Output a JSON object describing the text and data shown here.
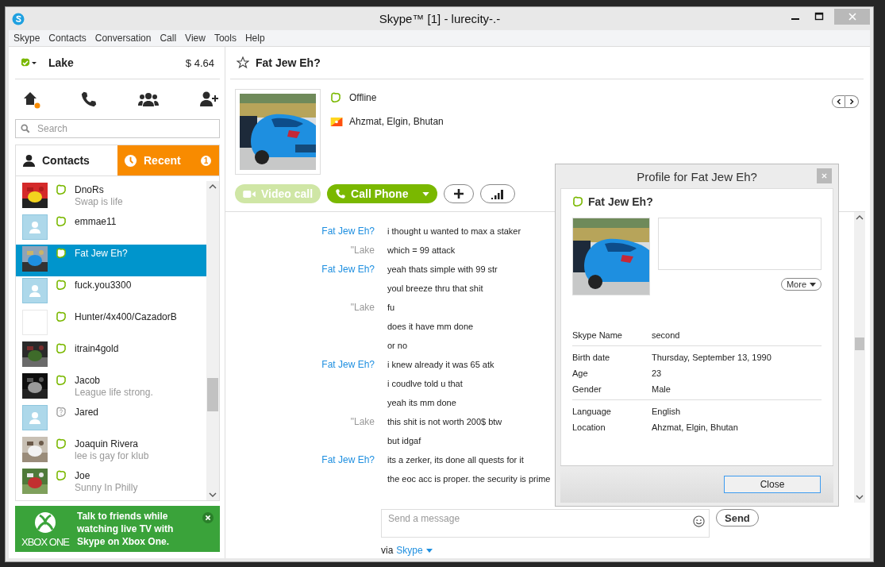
{
  "window": {
    "title": "Skype™ [1] - lurecity-.-"
  },
  "menu": [
    "Skype",
    "Contacts",
    "Conversation",
    "Call",
    "View",
    "Tools",
    "Help"
  ],
  "account": {
    "name": "Lake",
    "credit": "$ 4.64"
  },
  "search": {
    "placeholder": "Search"
  },
  "tabs": [
    {
      "label": "Contacts",
      "kind": "contacts",
      "selected": true
    },
    {
      "label": "Recent",
      "kind": "recent",
      "selected": false,
      "badge": "1"
    }
  ],
  "contacts": [
    {
      "name": "DnoRs",
      "mood": "Swap is life",
      "authorized": true,
      "kind": "picture",
      "selected": false
    },
    {
      "name": "emmae11",
      "authorized": true,
      "kind": "default",
      "selected": false
    },
    {
      "name": "Fat Jew Eh?",
      "authorized": true,
      "kind": "picture",
      "selected": true
    },
    {
      "name": "fuck.you3300",
      "authorized": true,
      "kind": "default",
      "selected": false
    },
    {
      "name": "Hunter/4x400/CazadorB",
      "authorized": true,
      "kind": "blank",
      "selected": false
    },
    {
      "name": "itrain4gold",
      "authorized": true,
      "kind": "picture",
      "selected": false
    },
    {
      "name": "Jacob",
      "mood": "League life strong.",
      "authorized": true,
      "kind": "picture",
      "selected": false
    },
    {
      "name": "Jared",
      "authorized": false,
      "kind": "default",
      "selected": false
    },
    {
      "name": "Joaquin Rivera",
      "mood": "lee is gay for klub",
      "authorized": true,
      "kind": "picture",
      "selected": false
    },
    {
      "name": "Joe",
      "mood": "Sunny In Philly",
      "authorized": true,
      "kind": "picture",
      "selected": false
    }
  ],
  "ad": {
    "brand": "XBOX ONE",
    "text": "Talk to friends while watching live TV with Skype on Xbox One."
  },
  "conversation": {
    "title": "Fat Jew Eh?",
    "status": "Offline",
    "location": "Ahzmat, Elgin, Bhutan"
  },
  "call_buttons": [
    {
      "label": "Video call",
      "kind": "video",
      "disabled": true
    },
    {
      "label": "Call Phone",
      "kind": "phone",
      "disabled": false
    }
  ],
  "messages": [
    {
      "sender": "Fat Jew Eh?",
      "kind": "contact",
      "text": "i thought u wanted to max a staker"
    },
    {
      "sender": "\"Lake",
      "kind": "self",
      "text": "which = 99 attack"
    },
    {
      "sender": "Fat Jew Eh?",
      "kind": "contact",
      "text": "yeah thats simple with 99 str"
    },
    {
      "kind": "continuation",
      "text": "youl breeze thru that shit"
    },
    {
      "sender": "\"Lake",
      "kind": "self",
      "text": "fu"
    },
    {
      "kind": "continuation",
      "text": "does it have mm done"
    },
    {
      "kind": "continuation",
      "text": "or no"
    },
    {
      "sender": "Fat Jew Eh?",
      "kind": "contact",
      "text": "i knew already it was 65 atk"
    },
    {
      "kind": "continuation",
      "text": "i coudlve told u that"
    },
    {
      "kind": "continuation",
      "text": "yeah its mm done"
    },
    {
      "sender": "\"Lake",
      "kind": "self",
      "text": "this shit is not worth 200$ btw"
    },
    {
      "kind": "continuation",
      "text": "but idgaf"
    },
    {
      "sender": "Fat Jew Eh?",
      "kind": "contact",
      "text": "its a zerker, its done all quests for it"
    },
    {
      "kind": "continuation",
      "text": "the eoc acc is proper. the security is prime"
    }
  ],
  "composer": {
    "placeholder": "Send a message",
    "send": "Send",
    "via": "via",
    "network": "Skype"
  },
  "profile": {
    "title": "Profile for Fat Jew Eh?",
    "name": "Fat Jew Eh?",
    "more": "More",
    "groups": [
      [
        {
          "label": "Skype Name",
          "value": "second"
        }
      ],
      [
        {
          "label": "Birth date",
          "value": "Thursday, September 13, 1990"
        },
        {
          "label": "Age",
          "value": "23"
        },
        {
          "label": "Gender",
          "value": "Male"
        }
      ],
      [
        {
          "label": "Language",
          "value": "English"
        },
        {
          "label": "Location",
          "value": "Ahzmat, Elgin, Bhutan"
        }
      ]
    ],
    "close": "Close"
  }
}
